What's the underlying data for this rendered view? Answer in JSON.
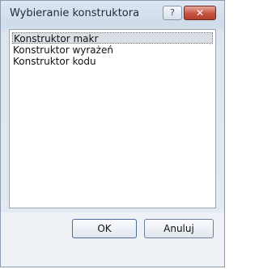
{
  "dialog": {
    "title": "Wybieranie konstruktora",
    "help_glyph": "?",
    "close_glyph": "✕"
  },
  "list": {
    "items": [
      {
        "label": "Konstruktor makr",
        "selected": true
      },
      {
        "label": "Konstruktor wyrażeń",
        "selected": false
      },
      {
        "label": "Konstruktor kodu",
        "selected": false
      }
    ]
  },
  "buttons": {
    "ok_label": "OK",
    "cancel_label": "Anuluj"
  }
}
